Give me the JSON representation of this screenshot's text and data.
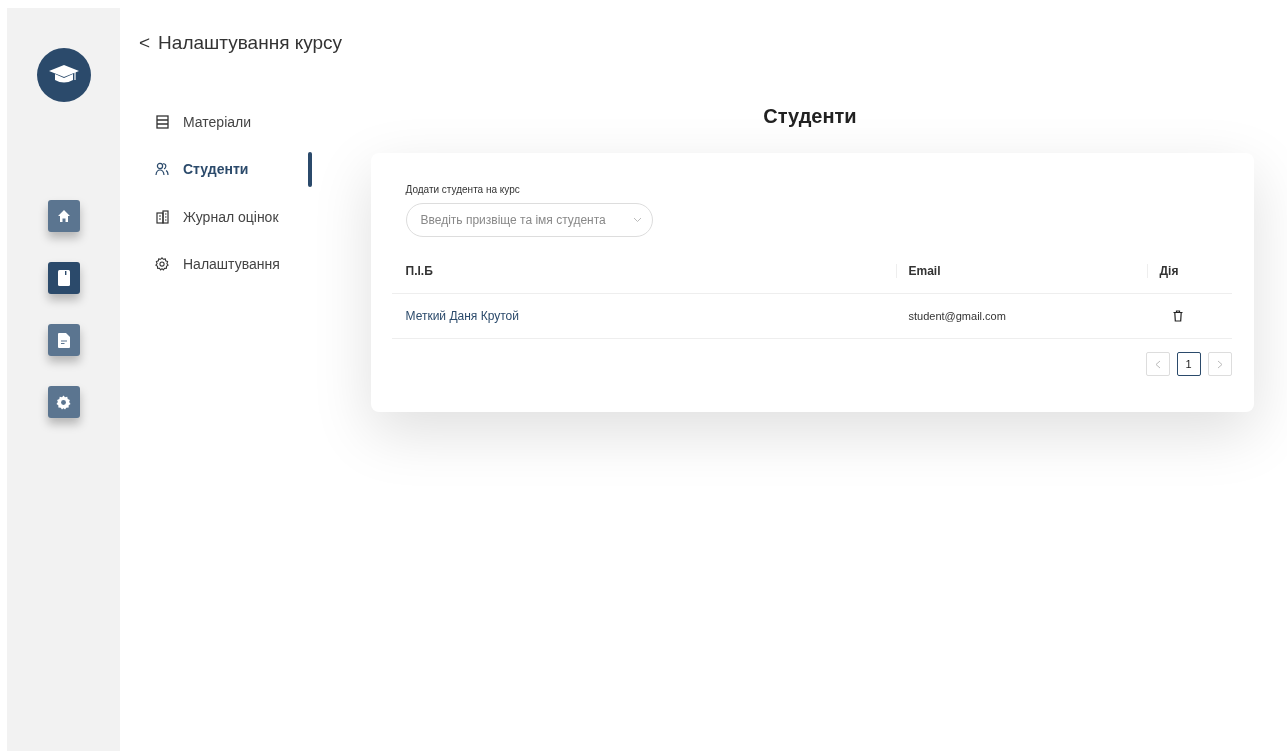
{
  "rail": {
    "items": [
      {
        "kind": "home",
        "selected": false
      },
      {
        "kind": "book",
        "selected": true
      },
      {
        "kind": "document",
        "selected": false
      },
      {
        "kind": "settings",
        "selected": false
      }
    ]
  },
  "header": {
    "back": "<",
    "title": "Налаштування курсу"
  },
  "menu": {
    "items": [
      {
        "kind": "materials",
        "label": "Матеріали",
        "selected": false
      },
      {
        "kind": "students",
        "label": "Студенти",
        "selected": true
      },
      {
        "kind": "journal",
        "label": "Журнал оцінок",
        "selected": false
      },
      {
        "kind": "settings",
        "label": "Налаштування",
        "selected": false
      }
    ]
  },
  "content": {
    "heading": "Студенти",
    "add_field": {
      "label": "Додати студента на курс",
      "placeholder": "Введіть призвіще та імя студента"
    },
    "table": {
      "columns": [
        "П.І.Б",
        "Email",
        "Дія"
      ],
      "rows": [
        {
          "name": "Меткий Даня Крутой",
          "email": "student@gmail.com"
        }
      ]
    },
    "pagination": {
      "prev_disabled": true,
      "next_disabled": true,
      "pages": [
        {
          "label": "1",
          "selected": true
        }
      ]
    }
  }
}
